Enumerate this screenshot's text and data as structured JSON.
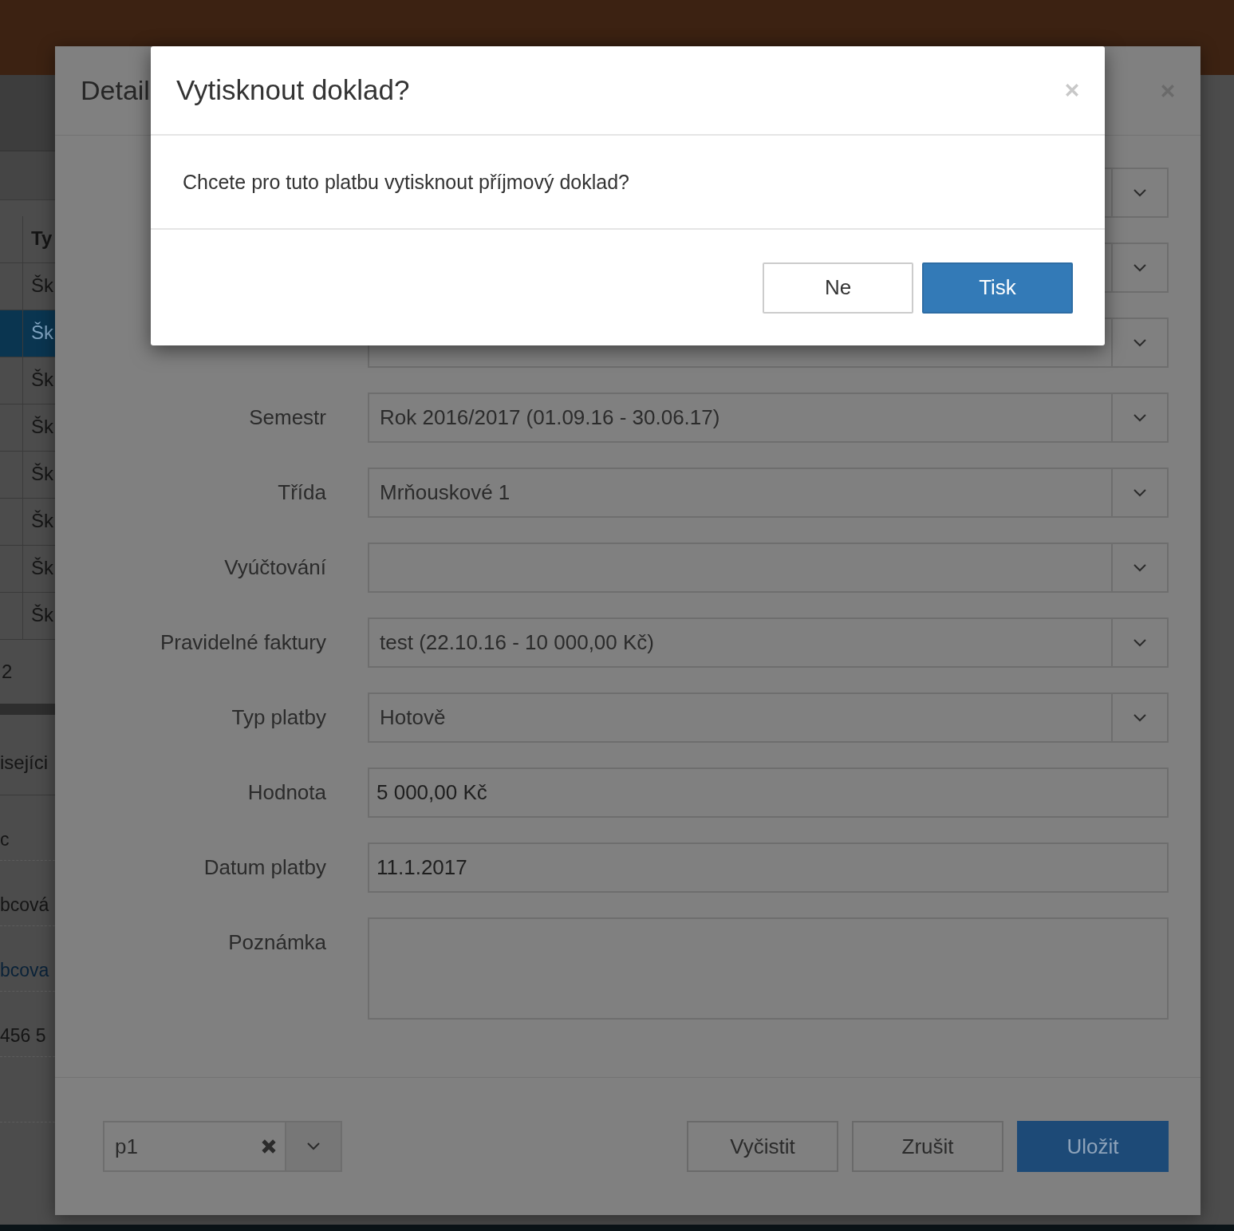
{
  "background_page": {
    "table_header": "Ty",
    "rows": [
      {
        "text": "Šk",
        "selected": false
      },
      {
        "text": "Šk",
        "selected": true
      },
      {
        "text": "Šk",
        "selected": false
      },
      {
        "text": "Šk",
        "selected": false
      },
      {
        "text": "Šk",
        "selected": false
      },
      {
        "text": "Šk",
        "selected": false
      },
      {
        "text": "Šk",
        "selected": false
      },
      {
        "text": "Šk",
        "selected": false
      }
    ],
    "pager": "2",
    "section_title": "isejíci",
    "details": [
      {
        "text": "c",
        "kind": "text"
      },
      {
        "text": "bcová",
        "kind": "text"
      },
      {
        "text": "bcova",
        "kind": "link"
      },
      {
        "text": "456 5",
        "kind": "text"
      }
    ]
  },
  "detail_dialog": {
    "title": "Detail",
    "fields": [
      {
        "kind": "select"
      },
      {
        "kind": "select"
      },
      {
        "kind": "select"
      },
      {
        "label": "Semestr",
        "kind": "select",
        "value": "Rok 2016/2017 (01.09.16 - 30.06.17)"
      },
      {
        "label": "Třída",
        "kind": "select",
        "value": "Mrňouskové 1"
      },
      {
        "label": "Vyúčtování",
        "kind": "select"
      },
      {
        "label": "Pravidelné faktury",
        "kind": "select",
        "value": "test (22.10.16 - 10 000,00 Kč)"
      },
      {
        "label": "Typ platby",
        "kind": "select",
        "value": "Hotově"
      },
      {
        "label": "Hodnota",
        "kind": "input",
        "value": "5 000,00 Kč"
      },
      {
        "label": "Datum platby",
        "kind": "input",
        "value": "11.1.2017"
      },
      {
        "label": "Poznámka",
        "kind": "textarea"
      }
    ],
    "footer_select": {
      "value": "p1"
    },
    "buttons": [
      {
        "label": "Vyčistit",
        "kind": "default"
      },
      {
        "label": "Zrušit",
        "kind": "default"
      },
      {
        "label": "Uložit",
        "kind": "primary"
      }
    ]
  },
  "confirm_dialog": {
    "title": "Vytisknout doklad?",
    "message": "Chcete pro tuto platbu vytisknout příjmový doklad?",
    "buttons": [
      {
        "label": "Ne",
        "kind": "default"
      },
      {
        "label": "Tisk",
        "kind": "primary"
      }
    ]
  }
}
